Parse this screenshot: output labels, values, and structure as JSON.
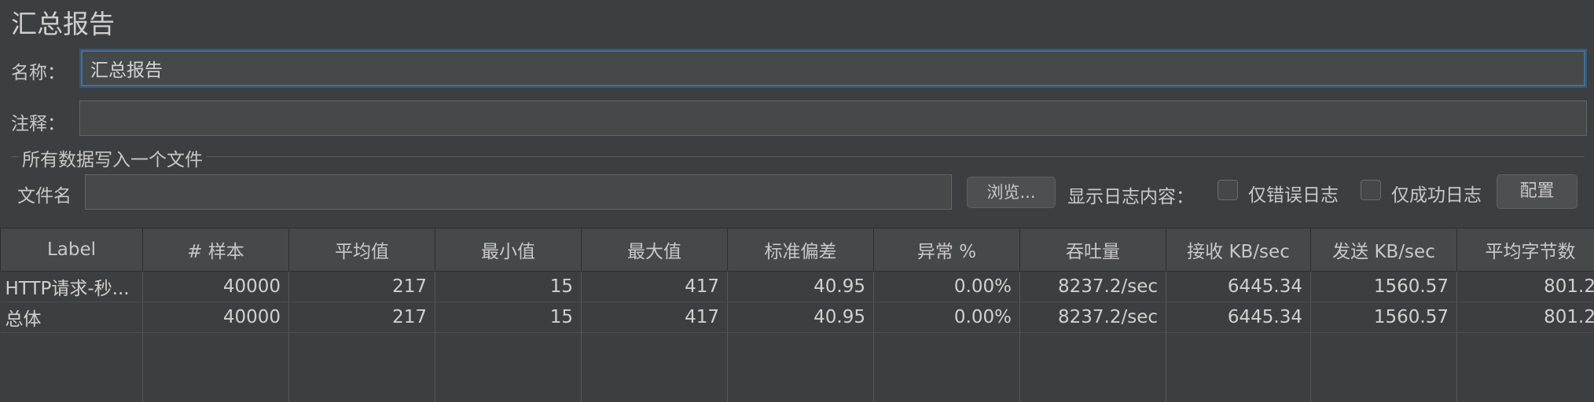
{
  "page": {
    "title": "汇总报告"
  },
  "form": {
    "name_label": "名称：",
    "name_value": "汇总报告",
    "comment_label": "注释：",
    "comment_value": ""
  },
  "file_group": {
    "title": "所有数据写入一个文件",
    "filename_label": "文件名",
    "filename_value": "",
    "browse_label": "浏览...",
    "log_content_label": "显示日志内容：",
    "errors_only_label": "仅错误日志",
    "errors_only_checked": false,
    "success_only_label": "仅成功日志",
    "success_only_checked": false,
    "configure_label": "配置"
  },
  "table": {
    "columns": [
      "Label",
      "# 样本",
      "平均值",
      "最小值",
      "最大值",
      "标准偏差",
      "异常 %",
      "吞吐量",
      "接收 KB/sec",
      "发送 KB/sec",
      "平均字节数"
    ],
    "rows": [
      [
        "HTTP请求-秒...",
        "40000",
        "217",
        "15",
        "417",
        "40.95",
        "0.00%",
        "8237.2/sec",
        "6445.34",
        "1560.57",
        "801.2"
      ],
      [
        "总体",
        "40000",
        "217",
        "15",
        "417",
        "40.95",
        "0.00%",
        "8237.2/sec",
        "6445.34",
        "1560.57",
        "801.2"
      ]
    ]
  }
}
